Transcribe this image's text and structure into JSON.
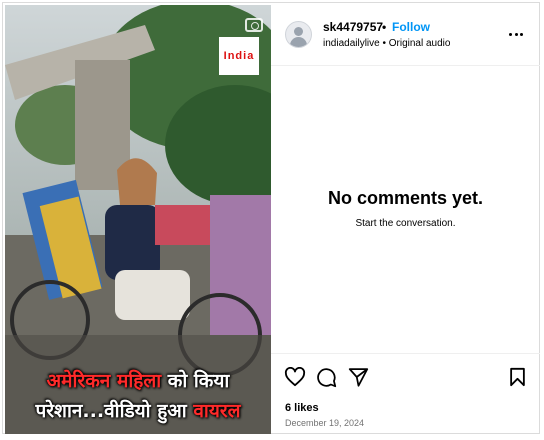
{
  "post": {
    "author": "sk4479757",
    "follow_label": "Follow",
    "separator": "•",
    "subline": "indiadailylive • Original audio",
    "more_label": "More options",
    "comments": {
      "empty_title": "No comments yet.",
      "empty_subtitle": "Start the conversation."
    },
    "likes": "6 likes",
    "date": "December 19, 2024",
    "actions": [
      "heart-icon",
      "comment-icon",
      "share-icon",
      "bookmark-icon"
    ]
  },
  "media": {
    "watermark": "India",
    "caption_line1_red": "अमेरिकन महिला",
    "caption_line1_white": " को किया",
    "caption_line2_white": "परेशान...वीडियो हुआ ",
    "caption_line2_red": "वायरल"
  },
  "colors": {
    "follow": "#0095f6",
    "caption_red": "#ff2a2a",
    "border": "#dbdbdb"
  }
}
